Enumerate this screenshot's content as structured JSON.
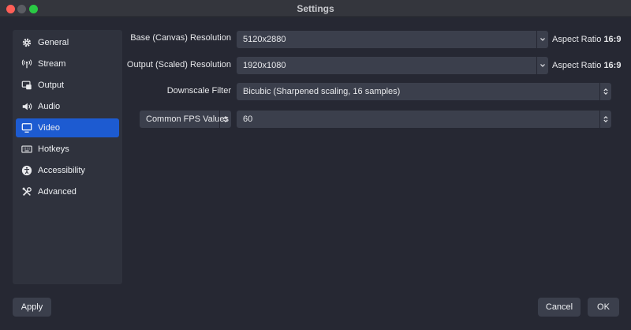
{
  "window": {
    "title": "Settings"
  },
  "sidebar": {
    "items": [
      {
        "label": "General",
        "icon": "gear-icon"
      },
      {
        "label": "Stream",
        "icon": "broadcast-icon"
      },
      {
        "label": "Output",
        "icon": "output-icon"
      },
      {
        "label": "Audio",
        "icon": "speaker-icon"
      },
      {
        "label": "Video",
        "icon": "monitor-icon",
        "selected": true
      },
      {
        "label": "Hotkeys",
        "icon": "keyboard-icon"
      },
      {
        "label": "Accessibility",
        "icon": "accessibility-icon"
      },
      {
        "label": "Advanced",
        "icon": "tools-icon"
      }
    ]
  },
  "video": {
    "base_resolution": {
      "label": "Base (Canvas) Resolution",
      "value": "5120x2880",
      "aspect_label": "Aspect Ratio",
      "aspect_value": "16:9"
    },
    "output_resolution": {
      "label": "Output (Scaled) Resolution",
      "value": "1920x1080",
      "aspect_label": "Aspect Ratio",
      "aspect_value": "16:9"
    },
    "downscale_filter": {
      "label": "Downscale Filter",
      "value": "Bicubic (Sharpened scaling, 16 samples)"
    },
    "fps": {
      "type_value": "Common FPS Values",
      "value": "60"
    }
  },
  "buttons": {
    "apply": "Apply",
    "cancel": "Cancel",
    "ok": "OK"
  },
  "colors": {
    "accent": "#1d5bd1",
    "background": "#262833",
    "panel": "#2f323d",
    "field": "#3b3f4c"
  }
}
